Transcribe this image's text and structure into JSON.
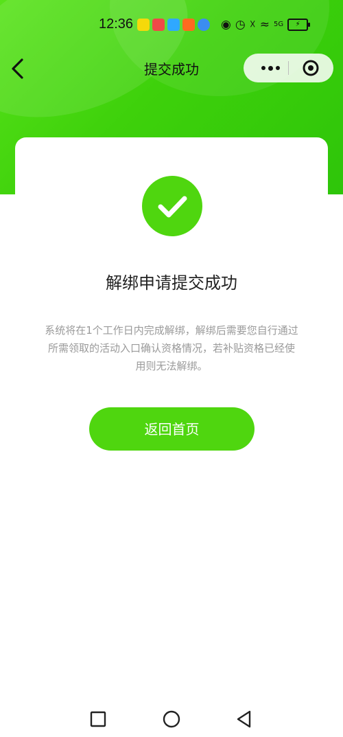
{
  "status_bar": {
    "time": "12:36",
    "app_icons": [
      "news-app-icon",
      "video-app-icon",
      "browser-app-icon",
      "shopping-app-icon",
      "globe-app-icon"
    ],
    "system_icons": [
      "eye-icon",
      "alarm-icon",
      "mute-icon",
      "wifi-icon",
      "signal-5g-icon",
      "battery-charging-icon"
    ],
    "network_label": "5G"
  },
  "header": {
    "title": "提交成功"
  },
  "result": {
    "title": "解绑申请提交成功",
    "description": "系统将在1个工作日内完成解绑，解绑后需要您自行通过所需领取的活动入口确认资格情况，若补贴资格已经使用则无法解绑。"
  },
  "actions": {
    "home_label": "返回首页"
  },
  "colors": {
    "accent": "#4fd60f",
    "header_bg": "#3ed10b",
    "title_text": "#222222",
    "desc_text": "#9a9a9a"
  }
}
